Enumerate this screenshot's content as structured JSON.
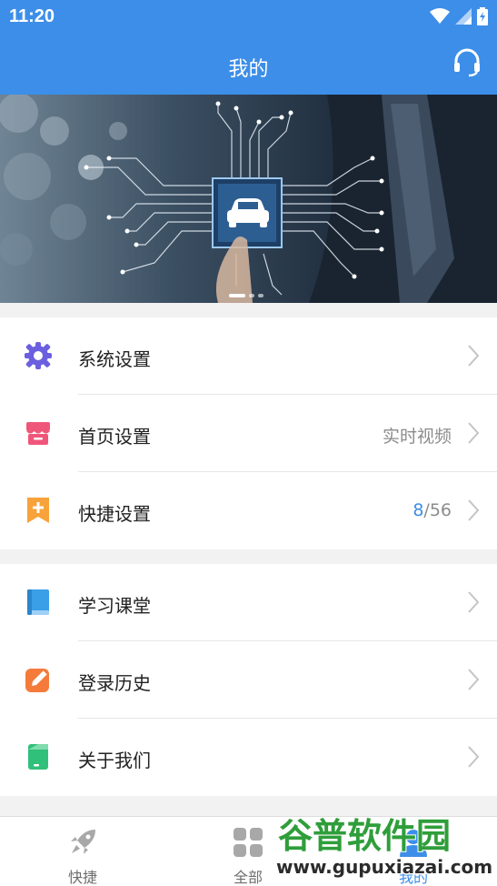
{
  "status_bar": {
    "time": "11:20"
  },
  "header": {
    "title": "我的"
  },
  "menu_group_1": [
    {
      "label": "系统设置",
      "value": ""
    },
    {
      "label": "首页设置",
      "value": "实时视频"
    },
    {
      "label": "快捷设置",
      "value_current": "8",
      "value_rest": "/56"
    }
  ],
  "menu_group_2": [
    {
      "label": "学习课堂"
    },
    {
      "label": "登录历史"
    },
    {
      "label": "关于我们"
    }
  ],
  "tabs": [
    {
      "label": "快捷",
      "icon": "rocket-icon"
    },
    {
      "label": "全部",
      "icon": "grid-icon"
    },
    {
      "label": "我的",
      "icon": "user-icon"
    }
  ],
  "watermark": {
    "brand": "谷普软件园",
    "url": "www.gupuxiazai.com"
  },
  "colors": {
    "primary": "#3d8ee8",
    "settings_icon": "#6b5fe0",
    "home_icon": "#f0567a",
    "quick_icon": "#f7a23a",
    "learn_icon": "#3b9fe8",
    "history_icon": "#f57b3b",
    "about_icon": "#30c07a"
  }
}
